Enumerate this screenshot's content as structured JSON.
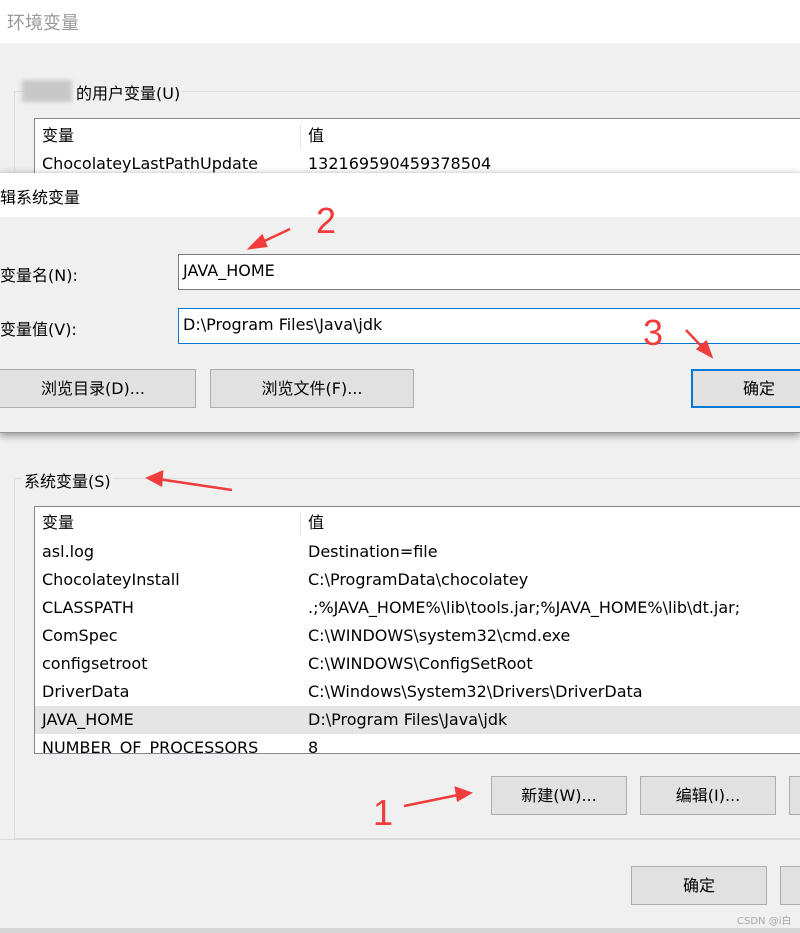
{
  "window": {
    "title": "环境变量"
  },
  "user_vars": {
    "label_suffix": "的用户变量(U)",
    "headers": [
      "变量",
      "值"
    ],
    "rows": [
      {
        "name": "ChocolateyLastPathUpdate",
        "value": "132169590459378504"
      }
    ]
  },
  "edit_dialog": {
    "title": "辑系统变量",
    "name_label": "变量名(N):",
    "name_value": "JAVA_HOME",
    "value_label": "变量值(V):",
    "value_value": "D:\\Program Files\\Java\\jdk",
    "browse_dir": "浏览目录(D)...",
    "browse_file": "浏览文件(F)...",
    "ok": "确定"
  },
  "system_vars": {
    "label": "系统变量(S)",
    "headers": [
      "变量",
      "值"
    ],
    "rows": [
      {
        "name": "asl.log",
        "value": "Destination=file"
      },
      {
        "name": "ChocolateyInstall",
        "value": "C:\\ProgramData\\chocolatey"
      },
      {
        "name": "CLASSPATH",
        "value": ".;%JAVA_HOME%\\lib\\tools.jar;%JAVA_HOME%\\lib\\dt.jar;"
      },
      {
        "name": "ComSpec",
        "value": "C:\\WINDOWS\\system32\\cmd.exe"
      },
      {
        "name": "configsetroot",
        "value": "C:\\WINDOWS\\ConfigSetRoot"
      },
      {
        "name": "DriverData",
        "value": "C:\\Windows\\System32\\Drivers\\DriverData"
      },
      {
        "name": "JAVA_HOME",
        "value": "D:\\Program Files\\Java\\jdk"
      },
      {
        "name": "NUMBER_OF_PROCESSORS",
        "value": "8"
      }
    ],
    "selected": "JAVA_HOME",
    "new_btn": "新建(W)...",
    "edit_btn": "编辑(I)..."
  },
  "footer": {
    "ok": "确定"
  },
  "annotations": {
    "step1": "1",
    "step2": "2",
    "step3": "3",
    "color": "#f03c3c"
  },
  "watermark": "CSDN @i白"
}
